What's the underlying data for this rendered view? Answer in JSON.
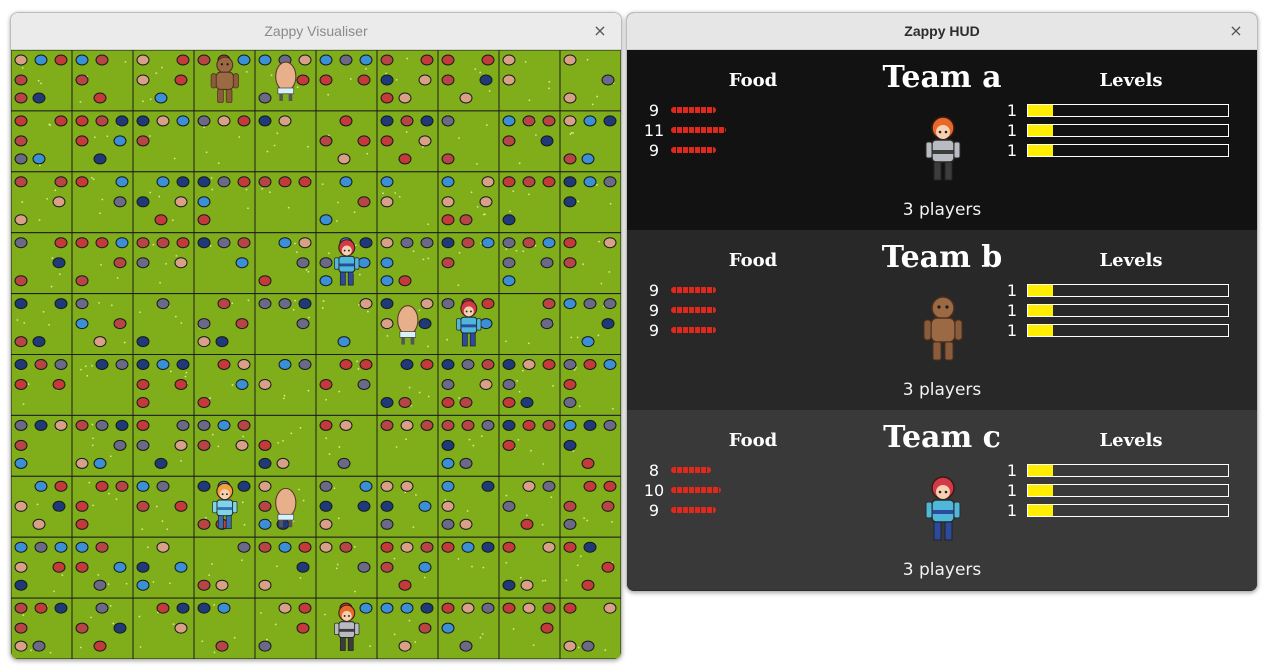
{
  "visualiser": {
    "title": "Zappy Visualiser",
    "close_glyph": "×",
    "grid": {
      "columns": 10,
      "rows": 10
    },
    "characters": [
      {
        "name": "brown-golem",
        "col": 3,
        "row": 0
      },
      {
        "name": "egg",
        "col": 4,
        "row": 0
      },
      {
        "name": "red-haired-mage",
        "col": 5,
        "row": 3
      },
      {
        "name": "egg",
        "col": 6,
        "row": 4
      },
      {
        "name": "red-haired-mage",
        "col": 7,
        "row": 4
      },
      {
        "name": "orange-haired-fighter",
        "col": 3,
        "row": 7
      },
      {
        "name": "egg",
        "col": 4,
        "row": 7
      },
      {
        "name": "armored-knight",
        "col": 5,
        "row": 9
      }
    ]
  },
  "hud": {
    "title": "Zappy HUD",
    "close_glyph": "×",
    "food_label": "Food",
    "levels_label": "Levels",
    "teams": [
      {
        "name": "Team a",
        "bg": "#121212",
        "avatar": "armored-knight",
        "players": "3 players",
        "food": [
          9,
          11,
          9
        ],
        "levels": [
          1,
          1,
          1
        ],
        "level_fraction": 0.125
      },
      {
        "name": "Team b",
        "bg": "#282828",
        "avatar": "brown-golem",
        "players": "3 players",
        "food": [
          9,
          9,
          9
        ],
        "levels": [
          1,
          1,
          1
        ],
        "level_fraction": 0.125
      },
      {
        "name": "Team c",
        "bg": "#393939",
        "avatar": "red-haired-mage",
        "players": "3 players",
        "food": [
          8,
          10,
          9
        ],
        "levels": [
          1,
          1,
          1
        ],
        "level_fraction": 0.125
      }
    ]
  }
}
